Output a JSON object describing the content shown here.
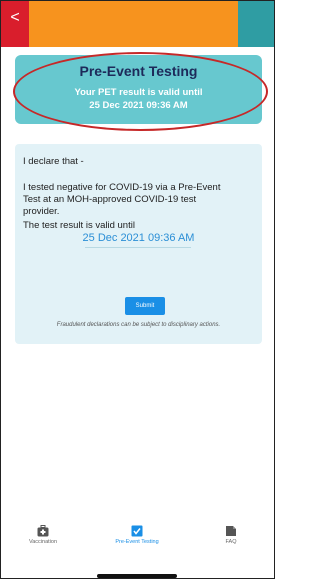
{
  "header": {
    "back_glyph": "<",
    "colors": {
      "left": "#d91e2c",
      "middle": "#f7931e",
      "right": "#2f9da3"
    }
  },
  "summary_card": {
    "title": "Pre-Event Testing",
    "line1": "Your PET result is valid until",
    "line2": "25 Dec 2021 09:36 AM"
  },
  "declaration": {
    "intro": "I declare that -",
    "statement_1": "I tested negative for COVID-19 via a Pre-Event",
    "statement_2": "Test at an MOH-approved COVID-19 test",
    "statement_3": "provider.",
    "valid_label": "The test result is valid until",
    "valid_date": "25 Dec 2021 09:36 AM",
    "submit_label": "Submit",
    "fraud_note": "Fraudulent declarations can be subject to disciplinary actions."
  },
  "tabs": [
    {
      "label": "Vaccination",
      "icon": "medkit-icon",
      "active": false
    },
    {
      "label": "Pre-Event Testing",
      "icon": "checkbox-icon",
      "active": true
    },
    {
      "label": "FAQ",
      "icon": "document-icon",
      "active": false
    }
  ],
  "accent_color": "#1a8fe6"
}
